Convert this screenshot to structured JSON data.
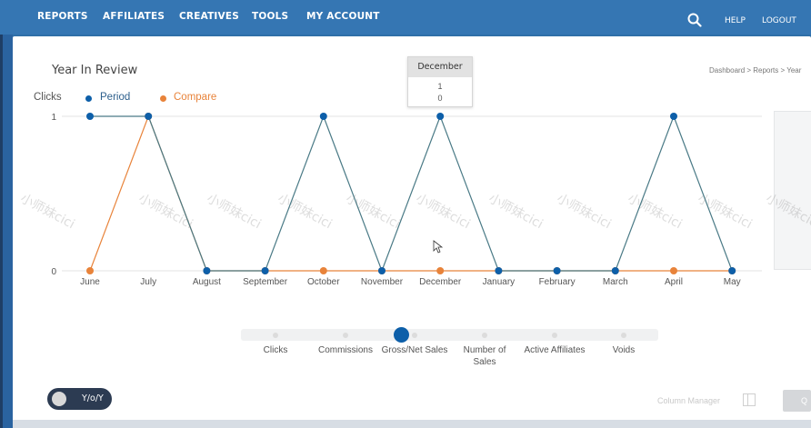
{
  "nav": {
    "items": [
      "REPORTS",
      "AFFILIATES",
      "CREATIVES",
      "TOOLS",
      "MY ACCOUNT"
    ],
    "help": "HELP",
    "logout": "LOGOUT"
  },
  "page": {
    "title": "Year In Review",
    "breadcrumb": "Dashboard > Reports > Year"
  },
  "tooltip": {
    "month": "December",
    "period_value": "1",
    "compare_value": "0"
  },
  "legend": {
    "clicks_label": "Clicks",
    "period_label": "Period",
    "compare_label": "Compare",
    "period_color": "#0d5fa9",
    "compare_color": "#e8833a"
  },
  "chart_data": {
    "type": "line",
    "ylabel": "Clicks",
    "ylim": [
      0,
      1
    ],
    "yticks": [
      "0",
      "1"
    ],
    "categories": [
      "June",
      "July",
      "August",
      "September",
      "October",
      "November",
      "December",
      "January",
      "February",
      "March",
      "April",
      "May"
    ],
    "series": [
      {
        "name": "Period",
        "color": "#0d5fa9",
        "values": [
          1,
          1,
          0,
          0,
          1,
          0,
          1,
          0,
          0,
          0,
          1,
          0
        ]
      },
      {
        "name": "Compare",
        "color": "#e8833a",
        "values": [
          0,
          1,
          0,
          0,
          0,
          0,
          0,
          0,
          0,
          0,
          0,
          0
        ]
      }
    ]
  },
  "metrics": {
    "items": [
      "Clicks",
      "Commissions",
      "Gross/Net Sales",
      "Number of Sales",
      "Active Affiliates",
      "Voids"
    ],
    "selected": "Gross/Net Sales"
  },
  "footer": {
    "toggle_label": "Y/o/Y",
    "column_manager": "Column Manager",
    "button_label": "Q"
  },
  "watermark": "小师妹cici"
}
